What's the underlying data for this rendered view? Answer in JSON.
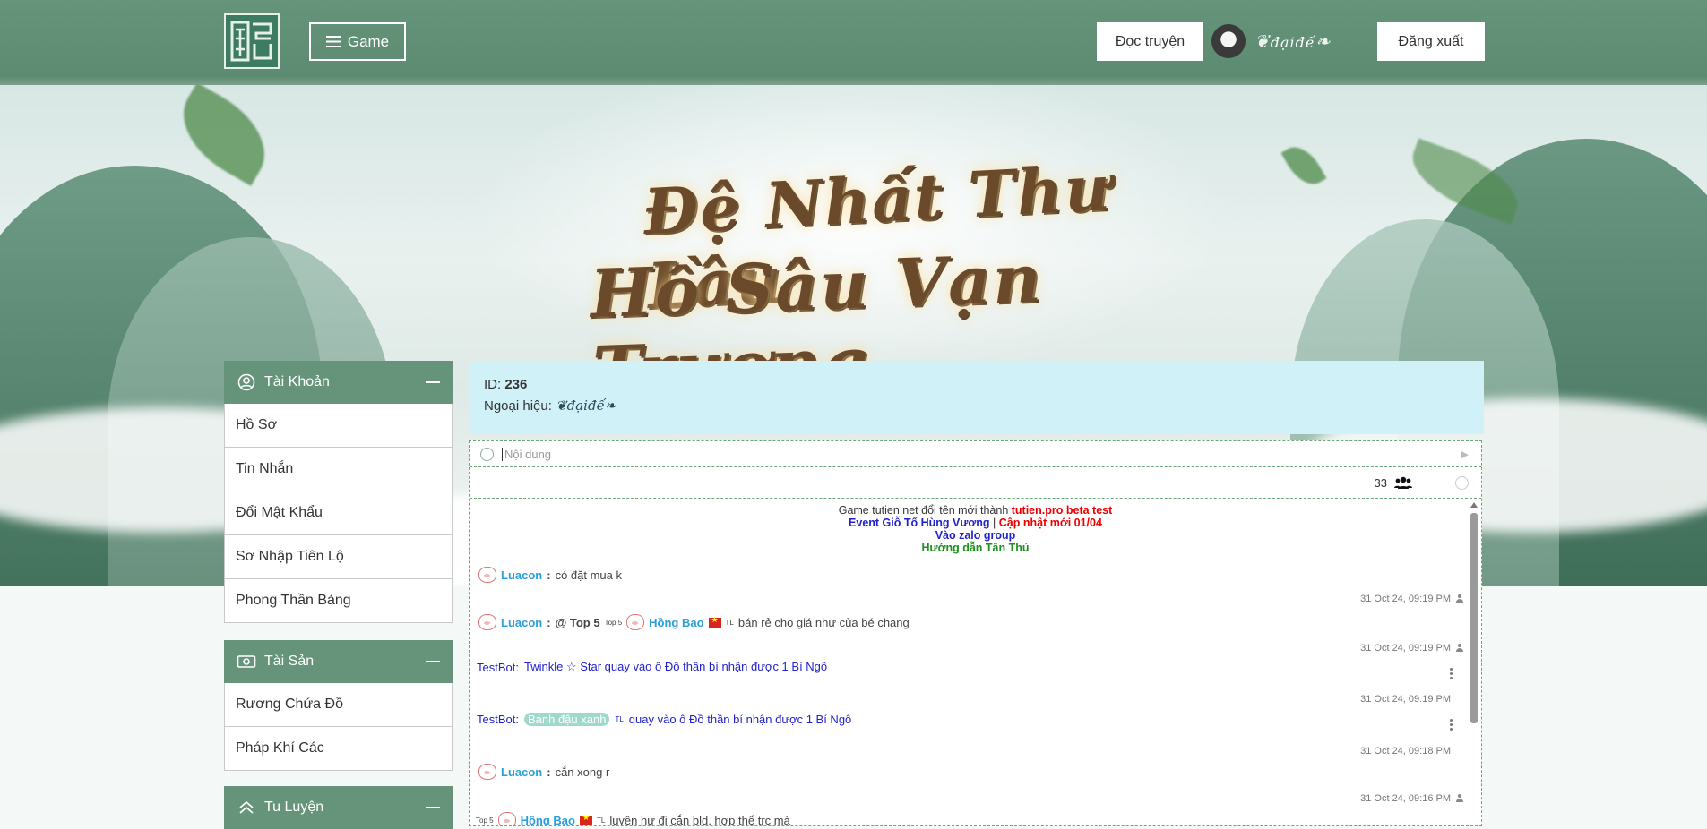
{
  "header": {
    "game_label": "Game",
    "read_label": "Đọc truyện",
    "username": "đạiđế",
    "logout_label": "Đăng xuất"
  },
  "banner": {
    "line1": "Đệ Nhất Thư Lâu",
    "line2": "Hồ Sâu Vạn Trượng"
  },
  "sidebar": {
    "account": {
      "title": "Tài Khoản",
      "items": [
        "Hồ Sơ",
        "Tin Nhắn",
        "Đổi Mật Khẩu",
        "Sơ Nhập Tiên Lộ",
        "Phong Thần Bảng"
      ]
    },
    "assets": {
      "title": "Tài Sản",
      "items": [
        "Rương Chứa Đồ",
        "Pháp Khí Các"
      ]
    },
    "cultivation": {
      "title": "Tu Luyện"
    }
  },
  "profile": {
    "id_label": "ID:",
    "id_value": "236",
    "nickname_label": "Ngoại hiệu:",
    "nickname": "đạiđế"
  },
  "chat": {
    "placeholder": "Nội dung",
    "online_count": "33",
    "notice": {
      "l1_pre": "Game tutien.net đổi tên mới thành ",
      "l1_red": "tutien.pro beta test",
      "l2_blue": "Event Giỗ Tổ Hùng Vương",
      "l2_sep": " | ",
      "l2_red": "Cập nhật mới 01/04",
      "l3": "Vào zalo group",
      "l4": "Hướng dẫn Tân Thủ"
    },
    "messages": [
      {
        "name": "Luacon",
        "text": "có đặt mua k",
        "time": "31 Oct 24, 09:19 PM"
      },
      {
        "name": "Luacon",
        "mention_pre": "@ Top 5",
        "mention_sup": "Top 5",
        "mention_name": "Hồng Bao",
        "mention_tag": "TL",
        "text": "bán rẻ cho giá như của bé chang",
        "time": "31 Oct 24, 09:19 PM"
      },
      {
        "bot": "TestBot:",
        "text": "Twinkle ☆ Star quay vào ô Đồ thần bí nhận được 1 Bí Ngô",
        "time": "31 Oct 24, 09:19 PM"
      },
      {
        "bot": "TestBot:",
        "player": "Bánh đậu xanh",
        "tag": "TL",
        "text": "quay vào ô Đồ thần bí nhận được 1 Bí Ngô",
        "time": "31 Oct 24, 09:18 PM"
      },
      {
        "name": "Luacon",
        "text": "cắn xong r",
        "time": "31 Oct 24, 09:16 PM"
      },
      {
        "prefix": "Top 5",
        "name": "Hồng Bao",
        "tag": "TL",
        "text": "luyện hư đi cắn bld, hợp thể trc mà"
      }
    ]
  }
}
